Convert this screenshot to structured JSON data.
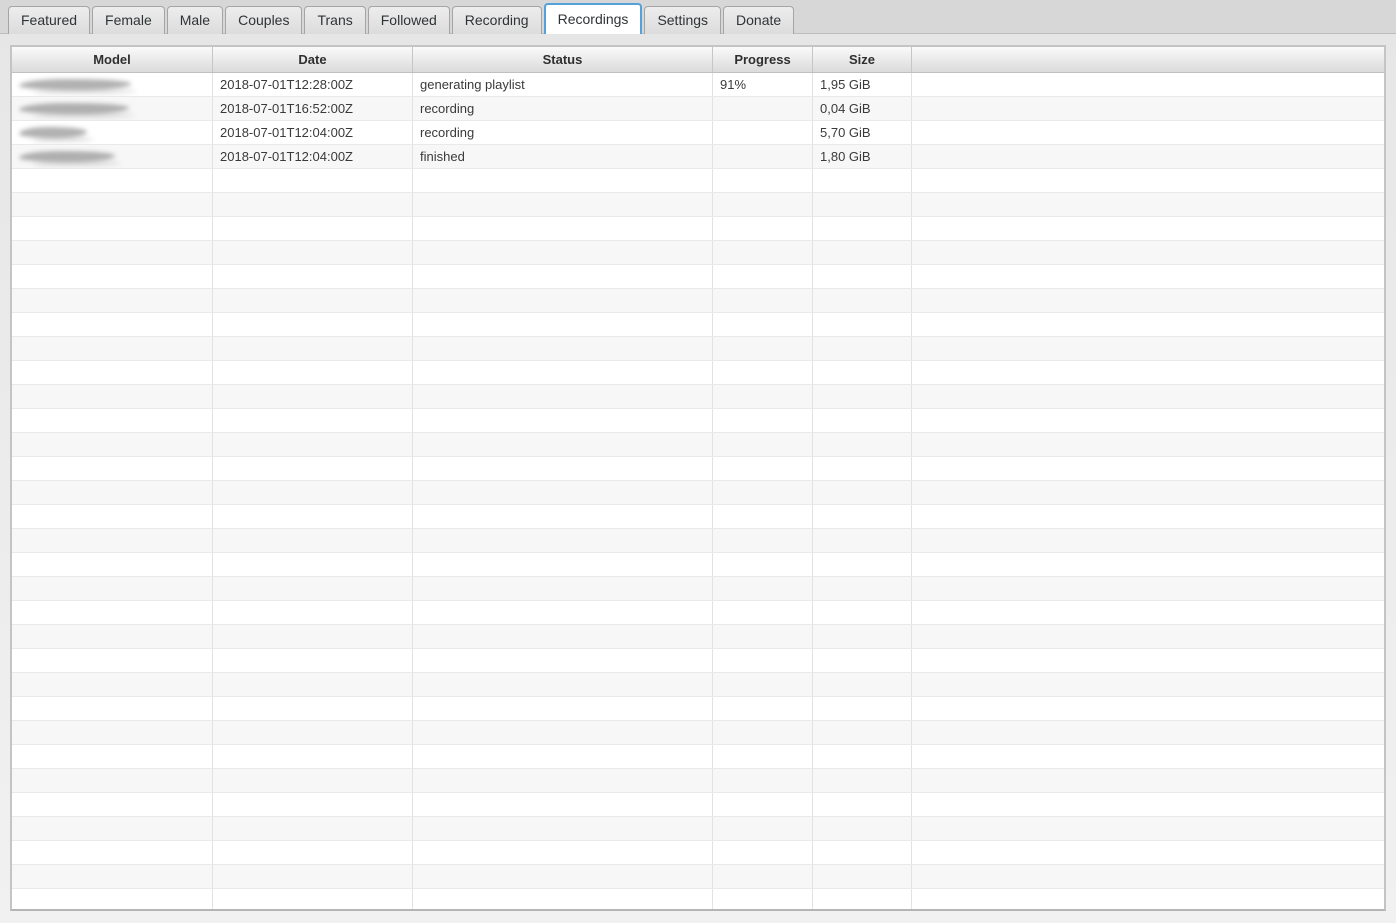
{
  "tabs": [
    {
      "label": "Featured",
      "active": false
    },
    {
      "label": "Female",
      "active": false
    },
    {
      "label": "Male",
      "active": false
    },
    {
      "label": "Couples",
      "active": false
    },
    {
      "label": "Trans",
      "active": false
    },
    {
      "label": "Followed",
      "active": false
    },
    {
      "label": "Recording",
      "active": false
    },
    {
      "label": "Recordings",
      "active": true
    },
    {
      "label": "Settings",
      "active": false
    },
    {
      "label": "Donate",
      "active": false
    }
  ],
  "table": {
    "columns": [
      {
        "label": "Model"
      },
      {
        "label": "Date"
      },
      {
        "label": "Status"
      },
      {
        "label": "Progress"
      },
      {
        "label": "Size"
      }
    ],
    "rows": [
      {
        "model_redacted": true,
        "model_blur_width": 112,
        "date": "2018-07-01T12:28:00Z",
        "status": "generating playlist",
        "progress": "91%",
        "size": "1,95 GiB"
      },
      {
        "model_redacted": true,
        "model_blur_width": 110,
        "date": "2018-07-01T16:52:00Z",
        "status": "recording",
        "progress": "",
        "size": "0,04 GiB"
      },
      {
        "model_redacted": true,
        "model_blur_width": 68,
        "date": "2018-07-01T12:04:00Z",
        "status": "recording",
        "progress": "",
        "size": "5,70 GiB"
      },
      {
        "model_redacted": true,
        "model_blur_width": 96,
        "date": "2018-07-01T12:04:00Z",
        "status": "finished",
        "progress": "",
        "size": "1,80 GiB"
      }
    ],
    "empty_row_count": 31
  },
  "colors": {
    "accent": "#55a1d9",
    "tab_strip": "#d7d7d7",
    "row_alt": "#f7f7f7",
    "table_border": "#c4c4c4"
  }
}
